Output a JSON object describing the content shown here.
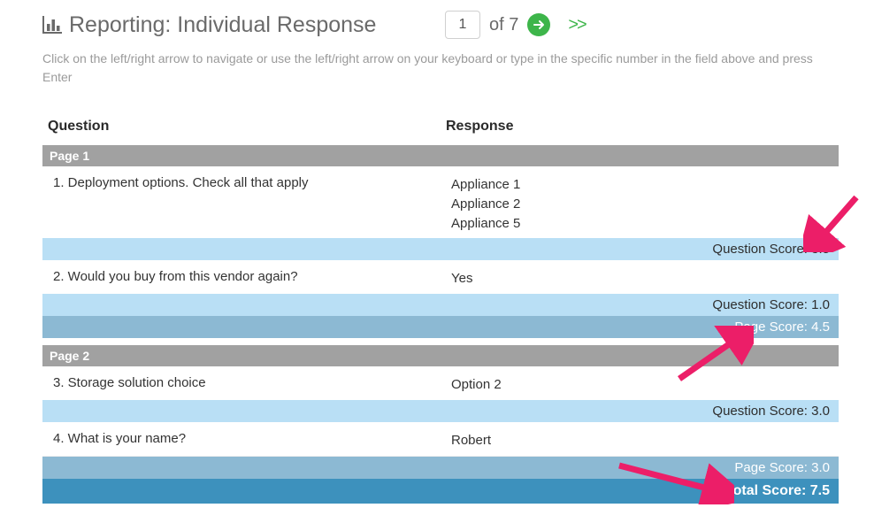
{
  "header": {
    "title": "Reporting: Individual Response",
    "nav": {
      "current": "1",
      "of_label": "of 7",
      "next_dbl": ">>"
    }
  },
  "instructions": "Click on the left/right arrow to navigate or use the left/right arrow on your keyboard or type in the specific number in the field above and press Enter",
  "columns": {
    "question": "Question",
    "response": "Response"
  },
  "pages": [
    {
      "label": "Page 1",
      "questions": [
        {
          "q": "1. Deployment options.  Check all that apply",
          "r": [
            "Appliance 1",
            "Appliance 2",
            "Appliance 5"
          ],
          "score_label": "Question Score: 3.5"
        },
        {
          "q": "2. Would you buy from this vendor again?",
          "r": [
            "Yes"
          ],
          "score_label": "Question Score: 1.0"
        }
      ],
      "page_score_label": "Page Score: 4.5"
    },
    {
      "label": "Page 2",
      "questions": [
        {
          "q": "3. Storage solution choice",
          "r": [
            "Option 2"
          ],
          "score_label": "Question Score: 3.0"
        },
        {
          "q": "4. What is your name?",
          "r": [
            "Robert"
          ],
          "score_label": ""
        }
      ],
      "page_score_label": "Page Score: 3.0"
    }
  ],
  "total_score_label": "Total Score: 7.5"
}
